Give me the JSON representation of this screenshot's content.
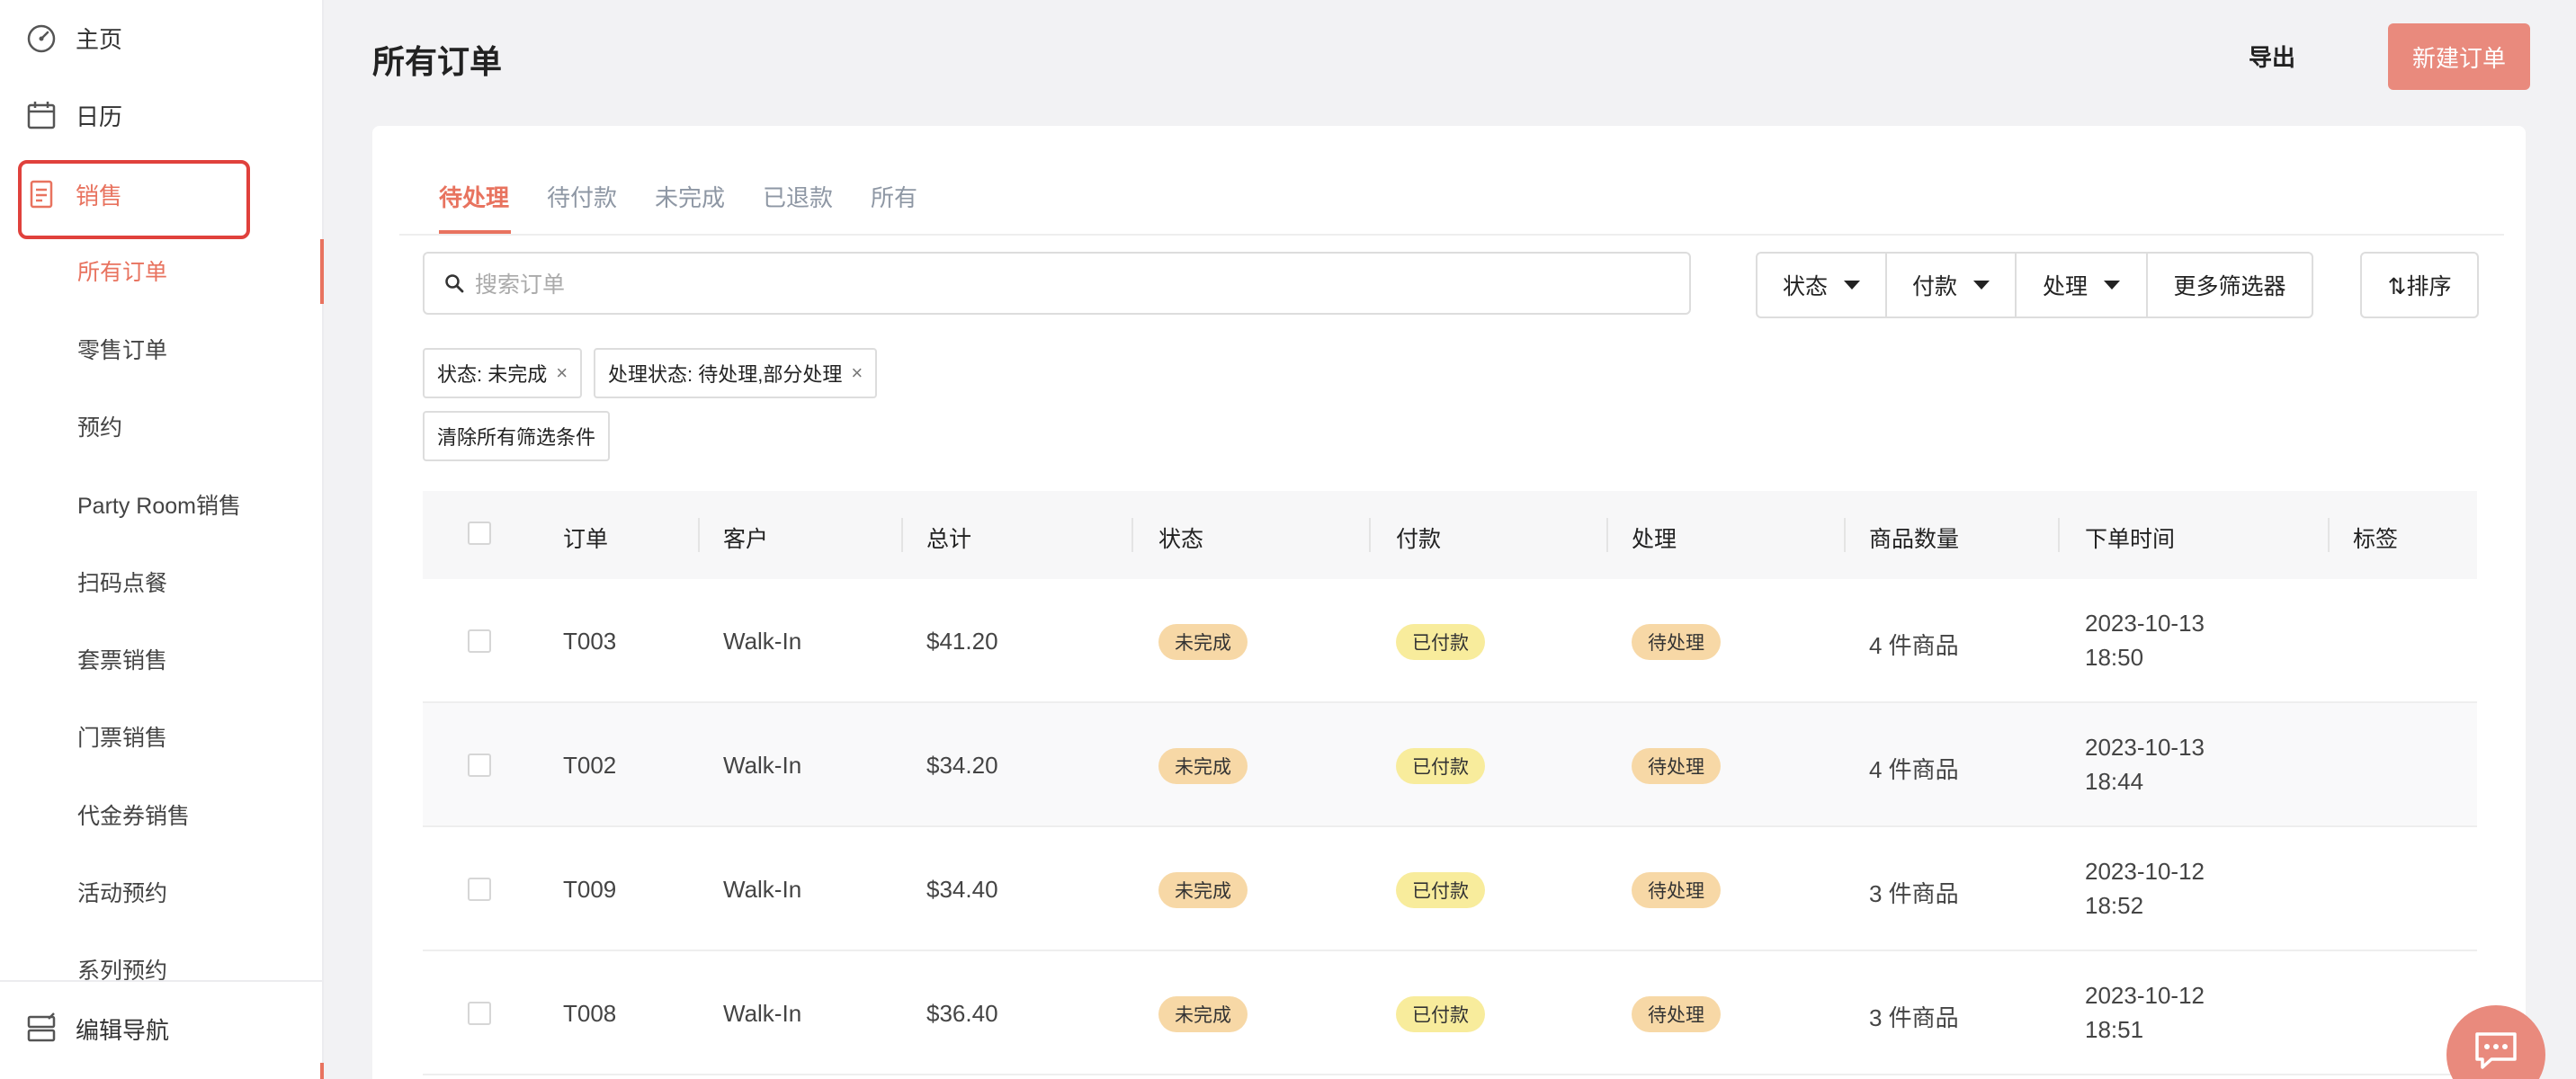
{
  "sidebar": {
    "items": [
      {
        "label": "主页",
        "icon": "dashboard-icon"
      },
      {
        "label": "日历",
        "icon": "calendar-icon"
      },
      {
        "label": "销售",
        "icon": "receipt-icon"
      }
    ],
    "sub_items": [
      {
        "label": "所有订单",
        "active": true
      },
      {
        "label": "零售订单"
      },
      {
        "label": "预约"
      },
      {
        "label": "Party Room销售"
      },
      {
        "label": "扫码点餐"
      },
      {
        "label": "套票销售"
      },
      {
        "label": "门票销售"
      },
      {
        "label": "代金券销售"
      },
      {
        "label": "活动预约"
      },
      {
        "label": "系列预约"
      }
    ],
    "edit_nav": "编辑导航"
  },
  "header": {
    "title": "所有订单",
    "export_label": "导出",
    "new_order_label": "新建订单"
  },
  "tabs": [
    "待处理",
    "待付款",
    "未完成",
    "已退款",
    "所有"
  ],
  "search": {
    "placeholder": "搜索订单"
  },
  "filters": {
    "status": "状态",
    "payment": "付款",
    "processing": "处理",
    "more": "更多筛选器",
    "sort": "⇅排序"
  },
  "chips": {
    "status_chip": "状态: 未完成",
    "processing_chip": "处理状态: 待处理,部分处理",
    "remove": "×",
    "clear_all": "清除所有筛选条件"
  },
  "table": {
    "headers": [
      "订单",
      "客户",
      "总计",
      "状态",
      "付款",
      "处理",
      "商品数量",
      "下单时间",
      "标签"
    ],
    "rows": [
      {
        "order": "T003",
        "customer": "Walk-In",
        "total": "$41.20",
        "status": "未完成",
        "payment": "已付款",
        "processing": "待处理",
        "items": "4 件商品",
        "date": "2023-10-13",
        "time": "18:50"
      },
      {
        "order": "T002",
        "customer": "Walk-In",
        "total": "$34.20",
        "status": "未完成",
        "payment": "已付款",
        "processing": "待处理",
        "items": "4 件商品",
        "date": "2023-10-13",
        "time": "18:44"
      },
      {
        "order": "T009",
        "customer": "Walk-In",
        "total": "$34.40",
        "status": "未完成",
        "payment": "已付款",
        "processing": "待处理",
        "items": "3 件商品",
        "date": "2023-10-12",
        "time": "18:52"
      },
      {
        "order": "T008",
        "customer": "Walk-In",
        "total": "$36.40",
        "status": "未完成",
        "payment": "已付款",
        "processing": "待处理",
        "items": "3 件商品",
        "date": "2023-10-12",
        "time": "18:51"
      }
    ]
  },
  "colors": {
    "accent": "#e8735f",
    "highlight_box": "#e0413c",
    "status_badge": "#f7d8a6",
    "payment_badge": "#f8ec9c"
  }
}
